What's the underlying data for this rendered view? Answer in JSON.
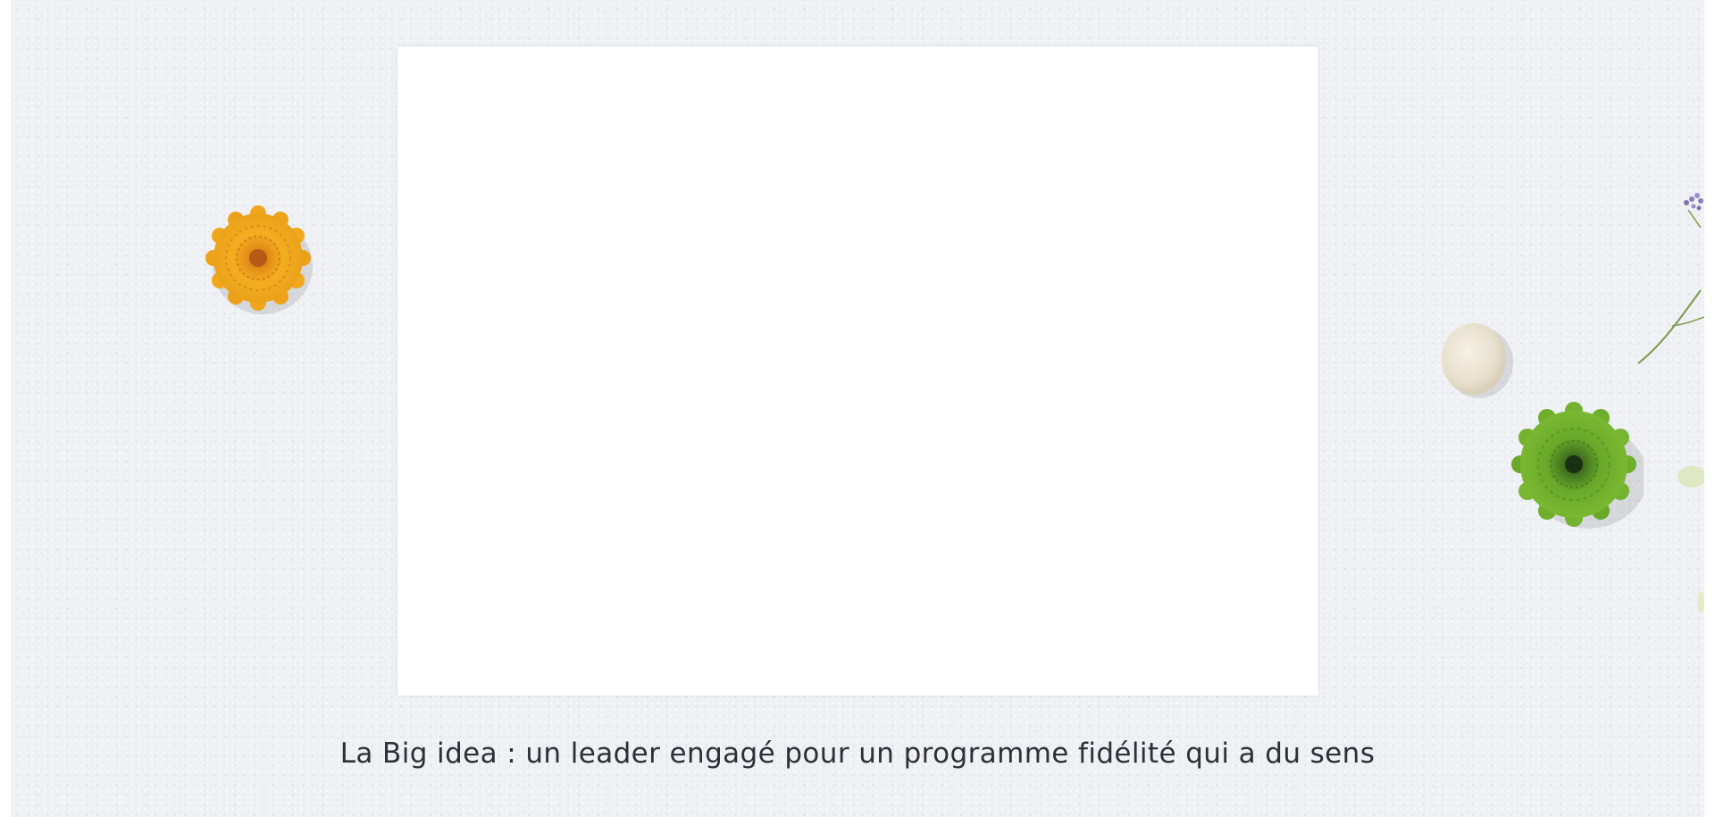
{
  "slide": {
    "caption": "La Big idea : un leader engagé pour un programme fidélité qui a du sens"
  },
  "colors": {
    "background": "#eef0f4",
    "frame": "#ffffff",
    "caption_text": "#2f2f36",
    "marigold": "#f2a91c",
    "chrysanthemum": "#6aa82a",
    "pebble": "#e9e2d3",
    "lavender": "#8a7fb8"
  },
  "decorations": [
    "marigold-flower-icon",
    "cream-pebble-icon",
    "green-chrysanthemum-icon",
    "lavender-sprig-icon",
    "leaf-icon"
  ]
}
